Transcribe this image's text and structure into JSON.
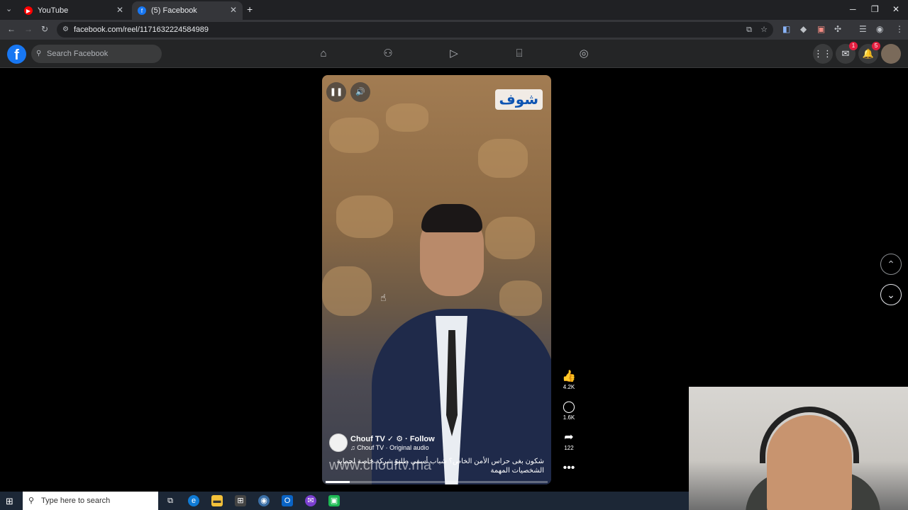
{
  "browser": {
    "tabs": [
      {
        "title": "YouTube",
        "icon": "youtube-icon"
      },
      {
        "title": "(5) Facebook",
        "icon": "facebook-icon",
        "active": true
      }
    ],
    "url": "facebook.com/reel/1171632224584989"
  },
  "facebook": {
    "search_placeholder": "Search Facebook",
    "nav": [
      "home-icon",
      "friends-icon",
      "watch-icon",
      "marketplace-icon",
      "gaming-icon"
    ],
    "messenger_badge": "1",
    "notifications_badge": "5"
  },
  "reel": {
    "channel_logo_text": "شوف",
    "owner_name": "Chouf TV ✓ ⚙ · Follow",
    "audio": "♫ Chouf TV · Original audio",
    "caption": "شكون بغى حراس الأمن الخاص؟ شباب أسفي طلبو شركة خاصة لحماية الشخصيات المهمة",
    "watermark": "www.chouftv.ma",
    "progress_fraction": 0.11,
    "likes": "4.2K",
    "comments": "1.6K",
    "shares": "122"
  },
  "taskbar": {
    "search_placeholder": "Type here to search"
  },
  "colors": {
    "fb_blue": "#1877f2",
    "badge_red": "#e41e3f"
  }
}
